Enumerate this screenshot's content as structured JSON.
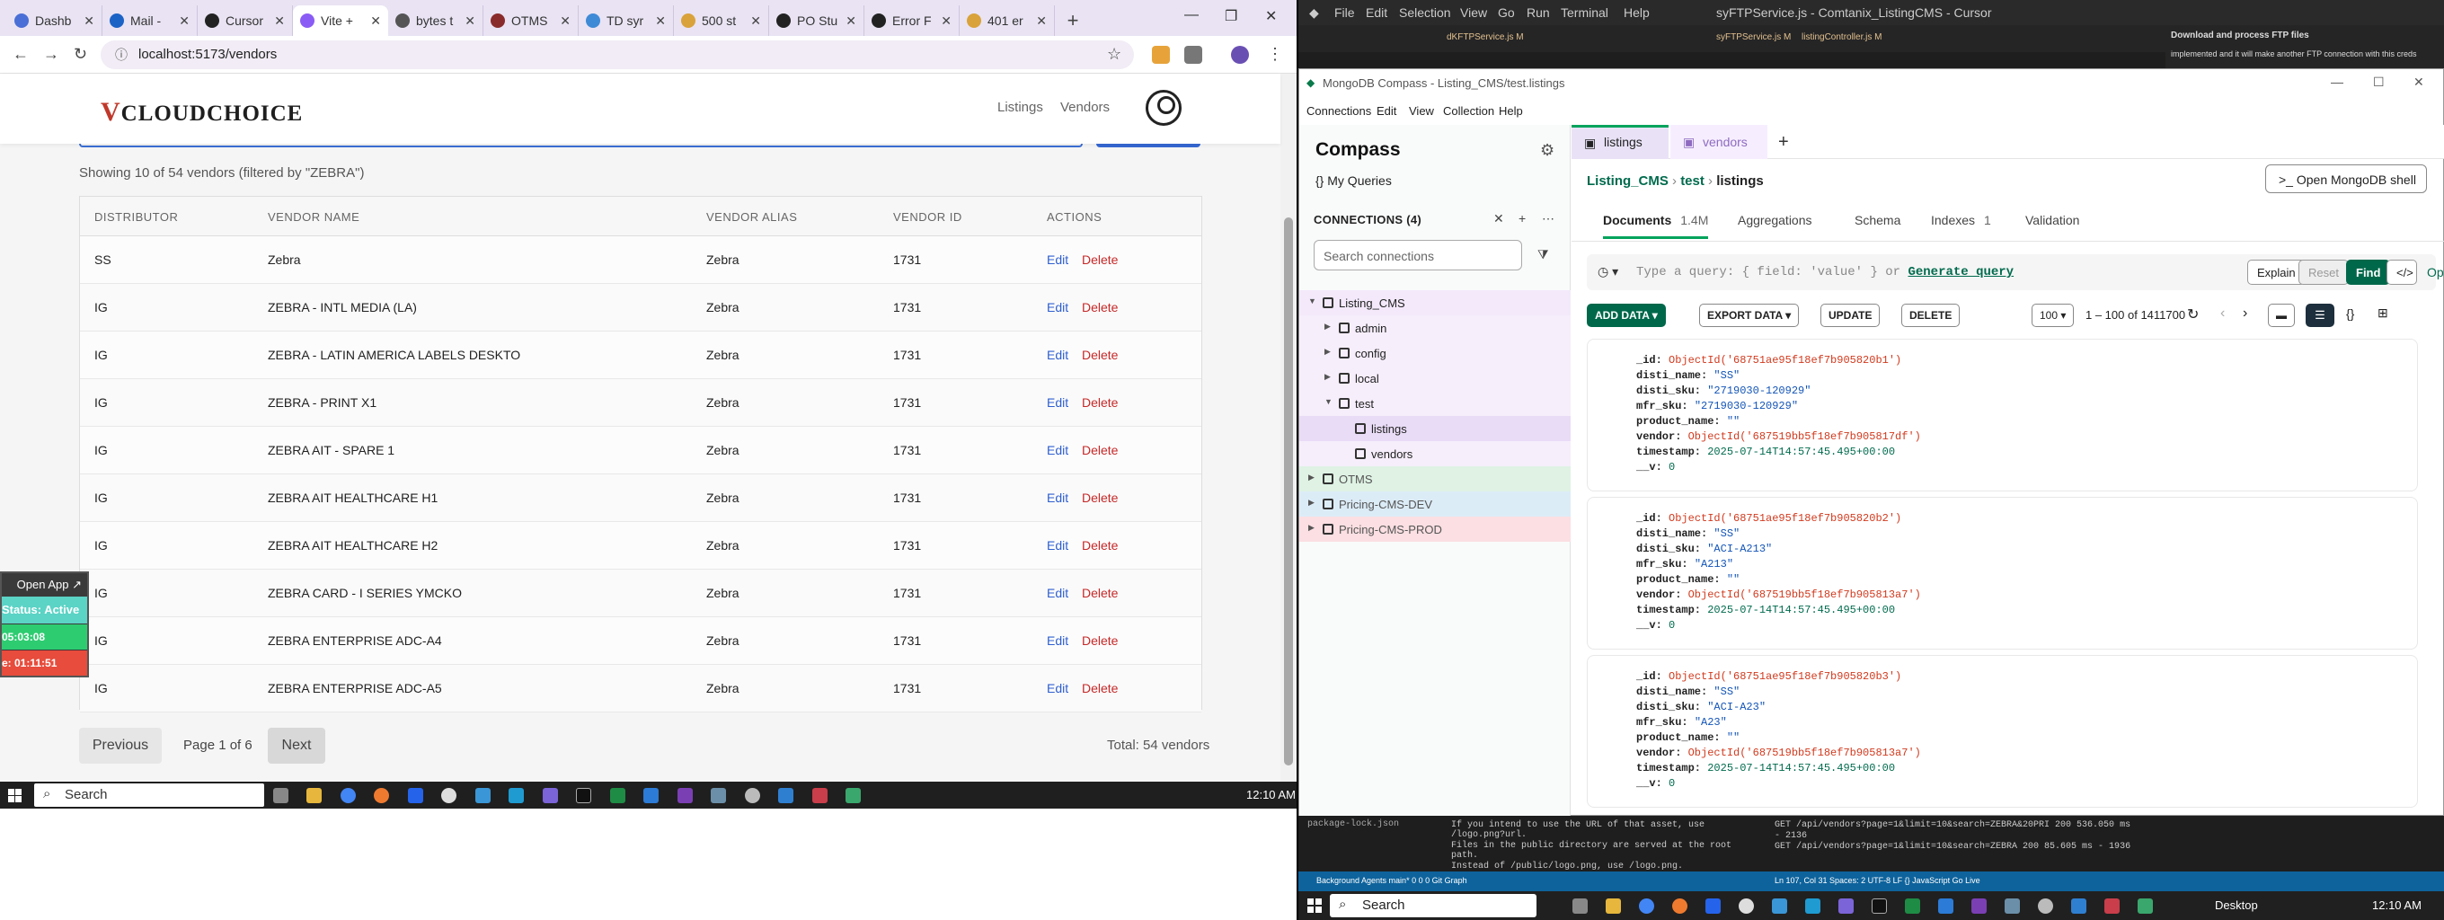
{
  "browser": {
    "tabs": [
      {
        "title": "Dashb",
        "color": "#4a6fd6"
      },
      {
        "title": "Mail - ",
        "color": "#1c63c6"
      },
      {
        "title": "Cursor",
        "color": "#222222"
      },
      {
        "title": "Vite + ",
        "color": "#8a5cf5"
      },
      {
        "title": "bytes t",
        "color": "#555555"
      },
      {
        "title": "OTMS",
        "color": "#8a2b2b"
      },
      {
        "title": "TD syr",
        "color": "#3f8ad6"
      },
      {
        "title": "500 st",
        "color": "#d9a23a"
      },
      {
        "title": "PO Stu",
        "color": "#222222"
      },
      {
        "title": "Error F",
        "color": "#222222"
      },
      {
        "title": "401 er",
        "color": "#d9a23a"
      }
    ],
    "url": "localhost:5173/vendors"
  },
  "app": {
    "logo": "CLOUDCHOICE",
    "nav": {
      "listings": "Listings",
      "vendors": "Vendors"
    },
    "showing": "Showing 10 of 54 vendors (filtered by \"ZEBRA\")",
    "columns": [
      "DISTRIBUTOR",
      "VENDOR NAME",
      "VENDOR ALIAS",
      "VENDOR ID",
      "ACTIONS"
    ],
    "edit_label": "Edit",
    "delete_label": "Delete",
    "rows": [
      {
        "dist": "SS",
        "name": "Zebra",
        "alias": "Zebra",
        "id": "1731"
      },
      {
        "dist": "IG",
        "name": "ZEBRA - INTL MEDIA (LA)",
        "alias": "Zebra",
        "id": "1731"
      },
      {
        "dist": "IG",
        "name": "ZEBRA - LATIN AMERICA LABELS DESKTO",
        "alias": "Zebra",
        "id": "1731"
      },
      {
        "dist": "IG",
        "name": "ZEBRA - PRINT X1",
        "alias": "Zebra",
        "id": "1731"
      },
      {
        "dist": "IG",
        "name": "ZEBRA AIT - SPARE 1",
        "alias": "Zebra",
        "id": "1731"
      },
      {
        "dist": "IG",
        "name": "ZEBRA AIT HEALTHCARE H1",
        "alias": "Zebra",
        "id": "1731"
      },
      {
        "dist": "IG",
        "name": "ZEBRA AIT HEALTHCARE H2",
        "alias": "Zebra",
        "id": "1731"
      },
      {
        "dist": "IG",
        "name": "ZEBRA CARD - I SERIES YMCKO",
        "alias": "Zebra",
        "id": "1731"
      },
      {
        "dist": "IG",
        "name": "ZEBRA ENTERPRISE ADC-A4",
        "alias": "Zebra",
        "id": "1731"
      },
      {
        "dist": "IG",
        "name": "ZEBRA ENTERPRISE ADC-A5",
        "alias": "Zebra",
        "id": "1731"
      }
    ],
    "pagination": {
      "prev": "Previous",
      "page": "Page 1 of 6",
      "next": "Next",
      "total": "Total: 54 vendors"
    }
  },
  "widget": {
    "open": "Open App ↗",
    "status": "Status: Active",
    "t1": "05:03:08",
    "t2": "e: 01:11:51"
  },
  "taskbar1": {
    "search": "Search",
    "clock": "12:10 AM"
  },
  "vscode": {
    "menu": [
      "File",
      "Edit",
      "Selection",
      "View",
      "Go",
      "Run",
      "Terminal",
      "Help"
    ],
    "title": "syFTPService.js - Comtanix_ListingCMS - Cursor",
    "tabs": [
      "dKFTPService.js M",
      "syFTPService.js M",
      "listingController.js M"
    ],
    "right_text": "Download and process FTP files",
    "right_sub": "implemented and it will make another FTP connection with this creds",
    "terminal_left": [
      "If you intend to use the URL of that asset, use /logo.png?url.",
      "Files in the public directory are served at the root path.",
      "Instead of /public/logo.png, use /logo.png."
    ],
    "terminal_right": [
      "GET /api/vendors?page=1&limit=10&search=ZEBRA&20PRI 200 536.050 ms",
      "- 2136",
      "GET /api/vendors?page=1&limit=10&search=ZEBRA 200 85.605 ms - 1936"
    ],
    "status_left": "Background Agents   main*   0 0 0   Git Graph",
    "status_right": "Ln 107, Col 31   Spaces: 2   UTF-8   LF   {} JavaScript   Go Live"
  },
  "compass": {
    "title": "MongoDB Compass - Listing_CMS/test.listings",
    "menu": [
      "Connections",
      "Edit",
      "View",
      "Collection",
      "Help"
    ],
    "brand": "Compass",
    "my_queries": "My Queries",
    "connections_header": "CONNECTIONS (4)",
    "search_placeholder": "Search connections",
    "tree": [
      {
        "label": "Listing_CMS",
        "level": 0,
        "arrow": "▼"
      },
      {
        "label": "admin",
        "level": 1,
        "arrow": "▶"
      },
      {
        "label": "config",
        "level": 1,
        "arrow": "▶"
      },
      {
        "label": "local",
        "level": 1,
        "arrow": "▶"
      },
      {
        "label": "test",
        "level": 1,
        "arrow": "▼"
      },
      {
        "label": "listings",
        "level": 2,
        "arrow": ""
      },
      {
        "label": "vendors",
        "level": 2,
        "arrow": ""
      },
      {
        "label": "OTMS",
        "level": 0,
        "arrow": "▶"
      },
      {
        "label": "Pricing-CMS-DEV",
        "level": 0,
        "arrow": "▶"
      },
      {
        "label": "Pricing-CMS-PROD",
        "level": 0,
        "arrow": "▶"
      }
    ],
    "tab_listings": "listings",
    "tab_vendors": "vendors",
    "breadcrumb": [
      "Listing_CMS",
      "test",
      "listings"
    ],
    "open_shell": ">_ Open MongoDB shell",
    "subtabs": {
      "documents": "Documents",
      "documents_count": "1.4M",
      "aggregations": "Aggregations",
      "schema": "Schema",
      "indexes": "Indexes",
      "indexes_count": "1",
      "validation": "Validation"
    },
    "query_placeholder": "Type a query: { field: 'value' } or",
    "generate_query": "Generate query",
    "explain": "Explain",
    "reset": "Reset",
    "find": "Find",
    "options": "Options ▸",
    "add_data": "ADD DATA ▾",
    "export_data": "EXPORT DATA ▾",
    "update": "UPDATE",
    "delete": "DELETE",
    "page_size": "100 ▾",
    "range": "1 – 100 of 1411700",
    "documents": [
      {
        "_id": "ObjectId('68751ae95f18ef7b905820b1')",
        "disti_name": "\"SS\"",
        "disti_sku": "\"2719030-120929\"",
        "mfr_sku": "\"2719030-120929\"",
        "product_name": "\"\"",
        "vendor": "ObjectId('687519bb5f18ef7b905817df')",
        "timestamp": "2025-07-14T14:57:45.495+00:00",
        "__v": "0"
      },
      {
        "_id": "ObjectId('68751ae95f18ef7b905820b2')",
        "disti_name": "\"SS\"",
        "disti_sku": "\"ACI-A213\"",
        "mfr_sku": "\"A213\"",
        "product_name": "\"\"",
        "vendor": "ObjectId('687519bb5f18ef7b905813a7')",
        "timestamp": "2025-07-14T14:57:45.495+00:00",
        "__v": "0"
      },
      {
        "_id": "ObjectId('68751ae95f18ef7b905820b3')",
        "disti_name": "\"SS\"",
        "disti_sku": "\"ACI-A23\"",
        "mfr_sku": "\"A23\"",
        "product_name": "\"\"",
        "vendor": "ObjectId('687519bb5f18ef7b905813a7')",
        "timestamp": "2025-07-14T14:57:45.495+00:00",
        "__v": "0"
      }
    ]
  },
  "taskbar2": {
    "search": "Search",
    "clock": "12:10 AM",
    "desktop": "Desktop"
  }
}
